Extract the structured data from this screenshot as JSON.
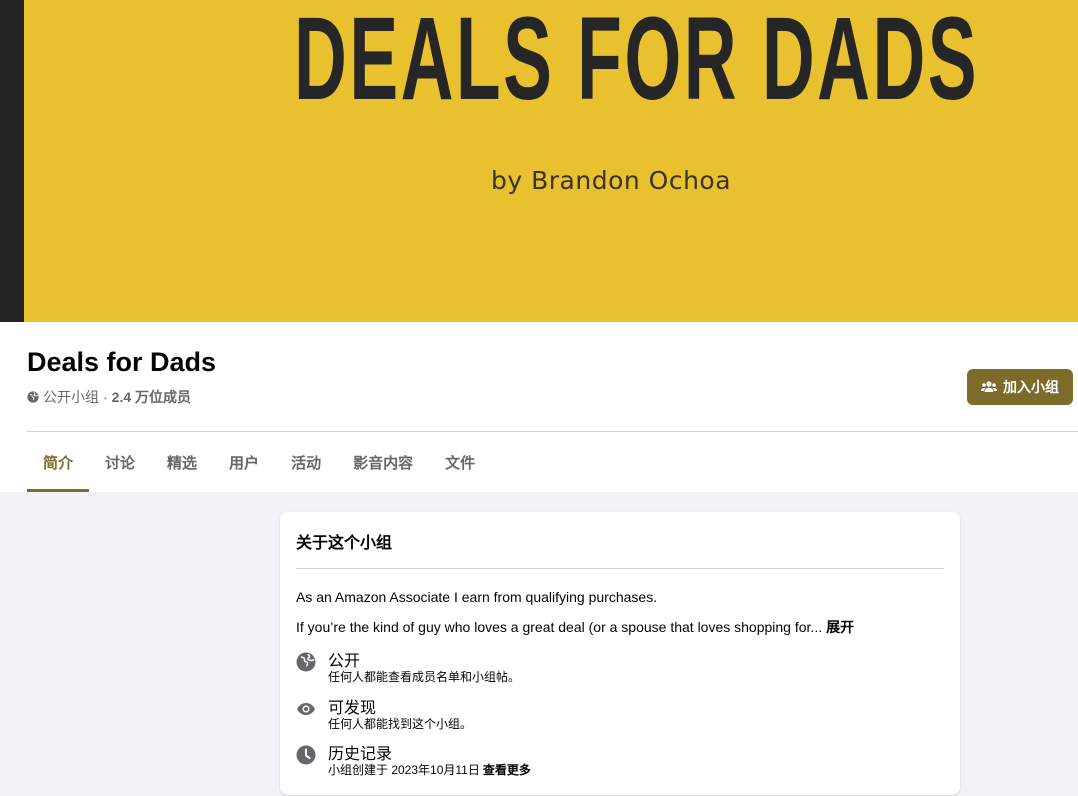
{
  "cover": {
    "title": "DEALS FOR DADS",
    "subtitle": "by Brandon Ochoa",
    "background_color": "#e9c12f",
    "edge_color": "#232323"
  },
  "group": {
    "name": "Deals for Dads",
    "privacy": "公开小组",
    "separator": "·",
    "members": "2.4 万位成员",
    "join_label": "加入小组",
    "accent_color": "#7c6b2b"
  },
  "tabs": [
    {
      "label": "简介",
      "active": true
    },
    {
      "label": "讨论",
      "active": false
    },
    {
      "label": "精选",
      "active": false
    },
    {
      "label": "用户",
      "active": false
    },
    {
      "label": "活动",
      "active": false
    },
    {
      "label": "影音内容",
      "active": false
    },
    {
      "label": "文件",
      "active": false
    }
  ],
  "about": {
    "title": "关于这个小组",
    "description_1": "As an Amazon Associate I earn from qualifying purchases.",
    "description_2": "If you’re the kind of guy who loves a great deal (or a spouse that loves shopping for...",
    "expand_label": "展开",
    "rows": [
      {
        "icon": "globe-icon",
        "label": "公开",
        "sub": "任何人都能查看成员名单和小组帖。"
      },
      {
        "icon": "eye-icon",
        "label": "可发现",
        "sub": "任何人都能找到这个小组。"
      },
      {
        "icon": "clock-icon",
        "label": "历史记录",
        "sub": "小组创建于 2023年10月11日",
        "link": "查看更多"
      }
    ]
  }
}
